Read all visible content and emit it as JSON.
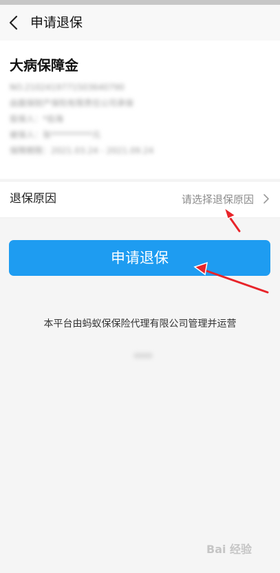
{
  "header": {
    "title": "申请退保",
    "back_icon": "chevron-left-icon"
  },
  "policy": {
    "title": "大病保障金",
    "details_redacted": [
      "NO.2102419771503640790",
      "由面保财产保险有限责任公司承保",
      "投保人：*伯海",
      "被保人：张**********元",
      "保障期限：2021.03.24 - 2021.09.24"
    ]
  },
  "reason": {
    "label": "退保原因",
    "placeholder": "请选择退保原因",
    "chevron_icon": "chevron-right-icon"
  },
  "submit": {
    "label": "申请退保",
    "color": "#1e9cf1"
  },
  "footer": {
    "text": "本平台由蚂蚁保保险代理有限公司管理并运营"
  },
  "annotations": {
    "arrow_color": "#e8242a"
  },
  "watermark": {
    "text": "Bai 经验"
  }
}
